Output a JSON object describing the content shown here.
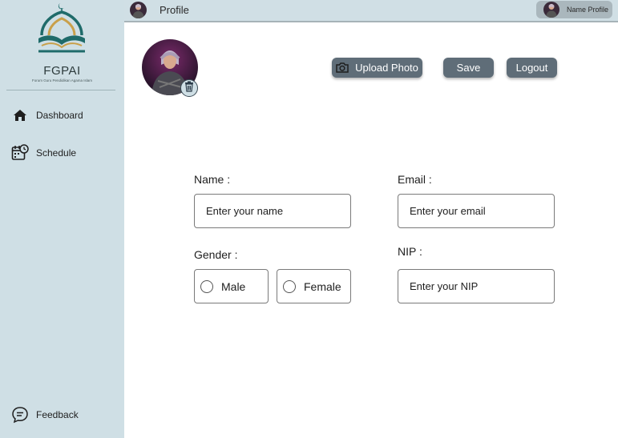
{
  "app": {
    "logo_title": "FGPAI",
    "logo_subtitle": "Forum Guru Pendidikan Agama Islam"
  },
  "sidebar": {
    "items": [
      {
        "label": "Dashboard",
        "icon": "home-icon"
      },
      {
        "label": "Schedule",
        "icon": "calendar-clock-icon"
      }
    ],
    "feedback": {
      "label": "Feedback",
      "icon": "chat-bubble-icon"
    }
  },
  "header": {
    "title": "Profile",
    "profile_chip_label": "Name Profile"
  },
  "actions": {
    "upload_label": "Upload Photo",
    "save_label": "Save",
    "logout_label": "Logout"
  },
  "form": {
    "name": {
      "label": "Name :",
      "placeholder": "Enter your name"
    },
    "email": {
      "label": "Email :",
      "placeholder": "Enter your email"
    },
    "gender": {
      "label": "Gender :",
      "options": [
        "Male",
        "Female"
      ]
    },
    "nip": {
      "label": "NIP :",
      "placeholder": "Enter your NIP"
    }
  },
  "colors": {
    "sidebar_bg": "#cfdfe5",
    "button_bg": "#5f6d78",
    "logo_teal": "#1f6b6a",
    "logo_gold": "#c9a04a"
  }
}
